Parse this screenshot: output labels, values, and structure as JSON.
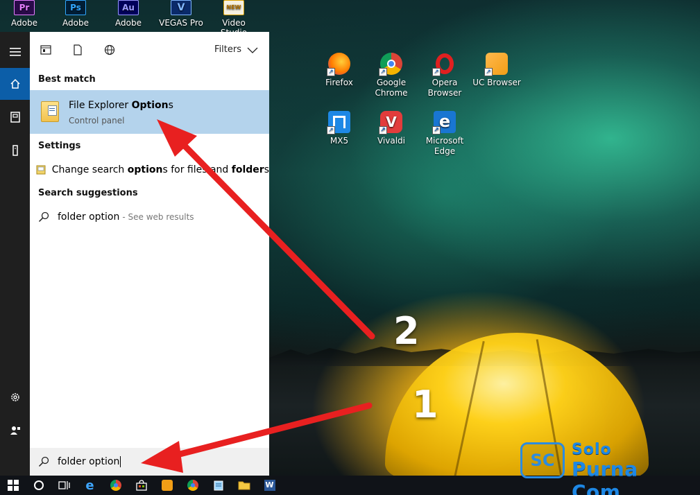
{
  "desktop_top_icons": [
    {
      "label": "Adobe",
      "color": "#2a0a4a",
      "accent": "#e57eff",
      "glyph": "Pr"
    },
    {
      "label": "Adobe",
      "color": "#001e36",
      "accent": "#31a8ff",
      "glyph": "Ps"
    },
    {
      "label": "Adobe",
      "color": "#00005b",
      "accent": "#9999ff",
      "glyph": "Au"
    },
    {
      "label": "VEGAS Pro",
      "color": "#0a2a6a",
      "accent": "#7fb6ff",
      "glyph": "V"
    },
    {
      "label": "Video Studio",
      "color": "#f5f0e0",
      "accent": "#d8a000",
      "glyph": "NEW"
    }
  ],
  "desktop_icons": [
    {
      "label": "Firefox",
      "icon": "firefox-icon",
      "color": "#ff7b00"
    },
    {
      "label": "Google Chrome",
      "icon": "chrome-icon",
      "color": "#4caf50"
    },
    {
      "label": "Opera Browser",
      "icon": "opera-icon",
      "color": "#e02020"
    },
    {
      "label": "UC Browser",
      "icon": "uc-browser-icon",
      "color": "#f29e16"
    },
    {
      "label": "MX5",
      "icon": "mx5-icon",
      "color": "#1e88e5"
    },
    {
      "label": "Vivaldi",
      "icon": "vivaldi-icon",
      "color": "#e23c3c"
    },
    {
      "label": "Microsoft Edge",
      "icon": "edge-icon",
      "color": "#1976d2"
    }
  ],
  "start_menu": {
    "filters_label": "Filters",
    "best_match_heading": "Best match",
    "best_match": {
      "title_plain": "File Explorer ",
      "title_bold": "Option",
      "title_tail": "s",
      "subtitle": "Control panel"
    },
    "settings_heading": "Settings",
    "settings_item": {
      "part1": "Change search ",
      "bold1": "option",
      "part2": "s for files and ",
      "bold2": "folder",
      "part3": "s"
    },
    "suggestions_heading": "Search suggestions",
    "suggestion": {
      "query": "folder option",
      "hint": "- See web results"
    },
    "search_value": "folder option"
  },
  "annotations": {
    "step1": "1",
    "step2": "2",
    "arrow_color": "#e82020"
  },
  "watermark": {
    "logo_text": "SC",
    "line1": "Solo",
    "line2": "Purna Com"
  }
}
